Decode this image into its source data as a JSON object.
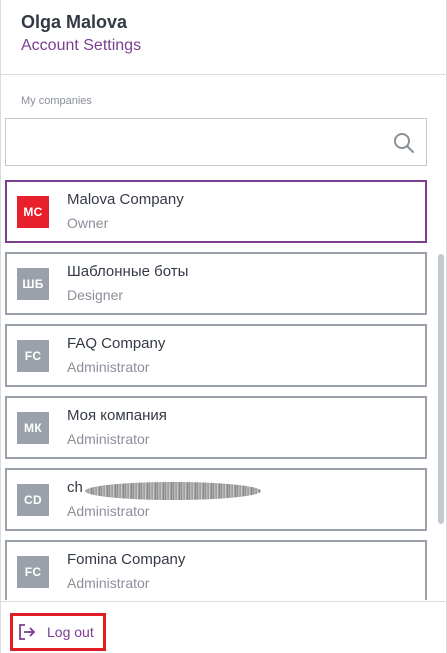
{
  "header": {
    "user_name": "Olga Malova",
    "account_settings_label": "Account Settings"
  },
  "companies_section": {
    "label": "My companies",
    "search_placeholder": "",
    "search_icon": "search-icon"
  },
  "companies": [
    {
      "initials": "MC",
      "name": "Malova Company",
      "role": "Owner",
      "selected": true
    },
    {
      "initials": "ШБ",
      "name": "Шаблонные боты",
      "role": "Designer",
      "selected": false
    },
    {
      "initials": "FC",
      "name": "FAQ Company",
      "role": "Administrator",
      "selected": false
    },
    {
      "initials": "МК",
      "name": "Моя компания",
      "role": "Administrator",
      "selected": false
    },
    {
      "initials": "CD",
      "name": "ch",
      "role": "Administrator",
      "selected": false
    },
    {
      "initials": "FC",
      "name": "Fomina Company",
      "role": "Administrator",
      "selected": false
    }
  ],
  "footer": {
    "logout_label": "Log out",
    "logout_icon": "logout-icon"
  },
  "colors": {
    "accent": "#7b3f92",
    "selected_avatar": "#e8202b",
    "avatar_gray": "#9ba1aa",
    "highlight_box": "#e11d25"
  }
}
